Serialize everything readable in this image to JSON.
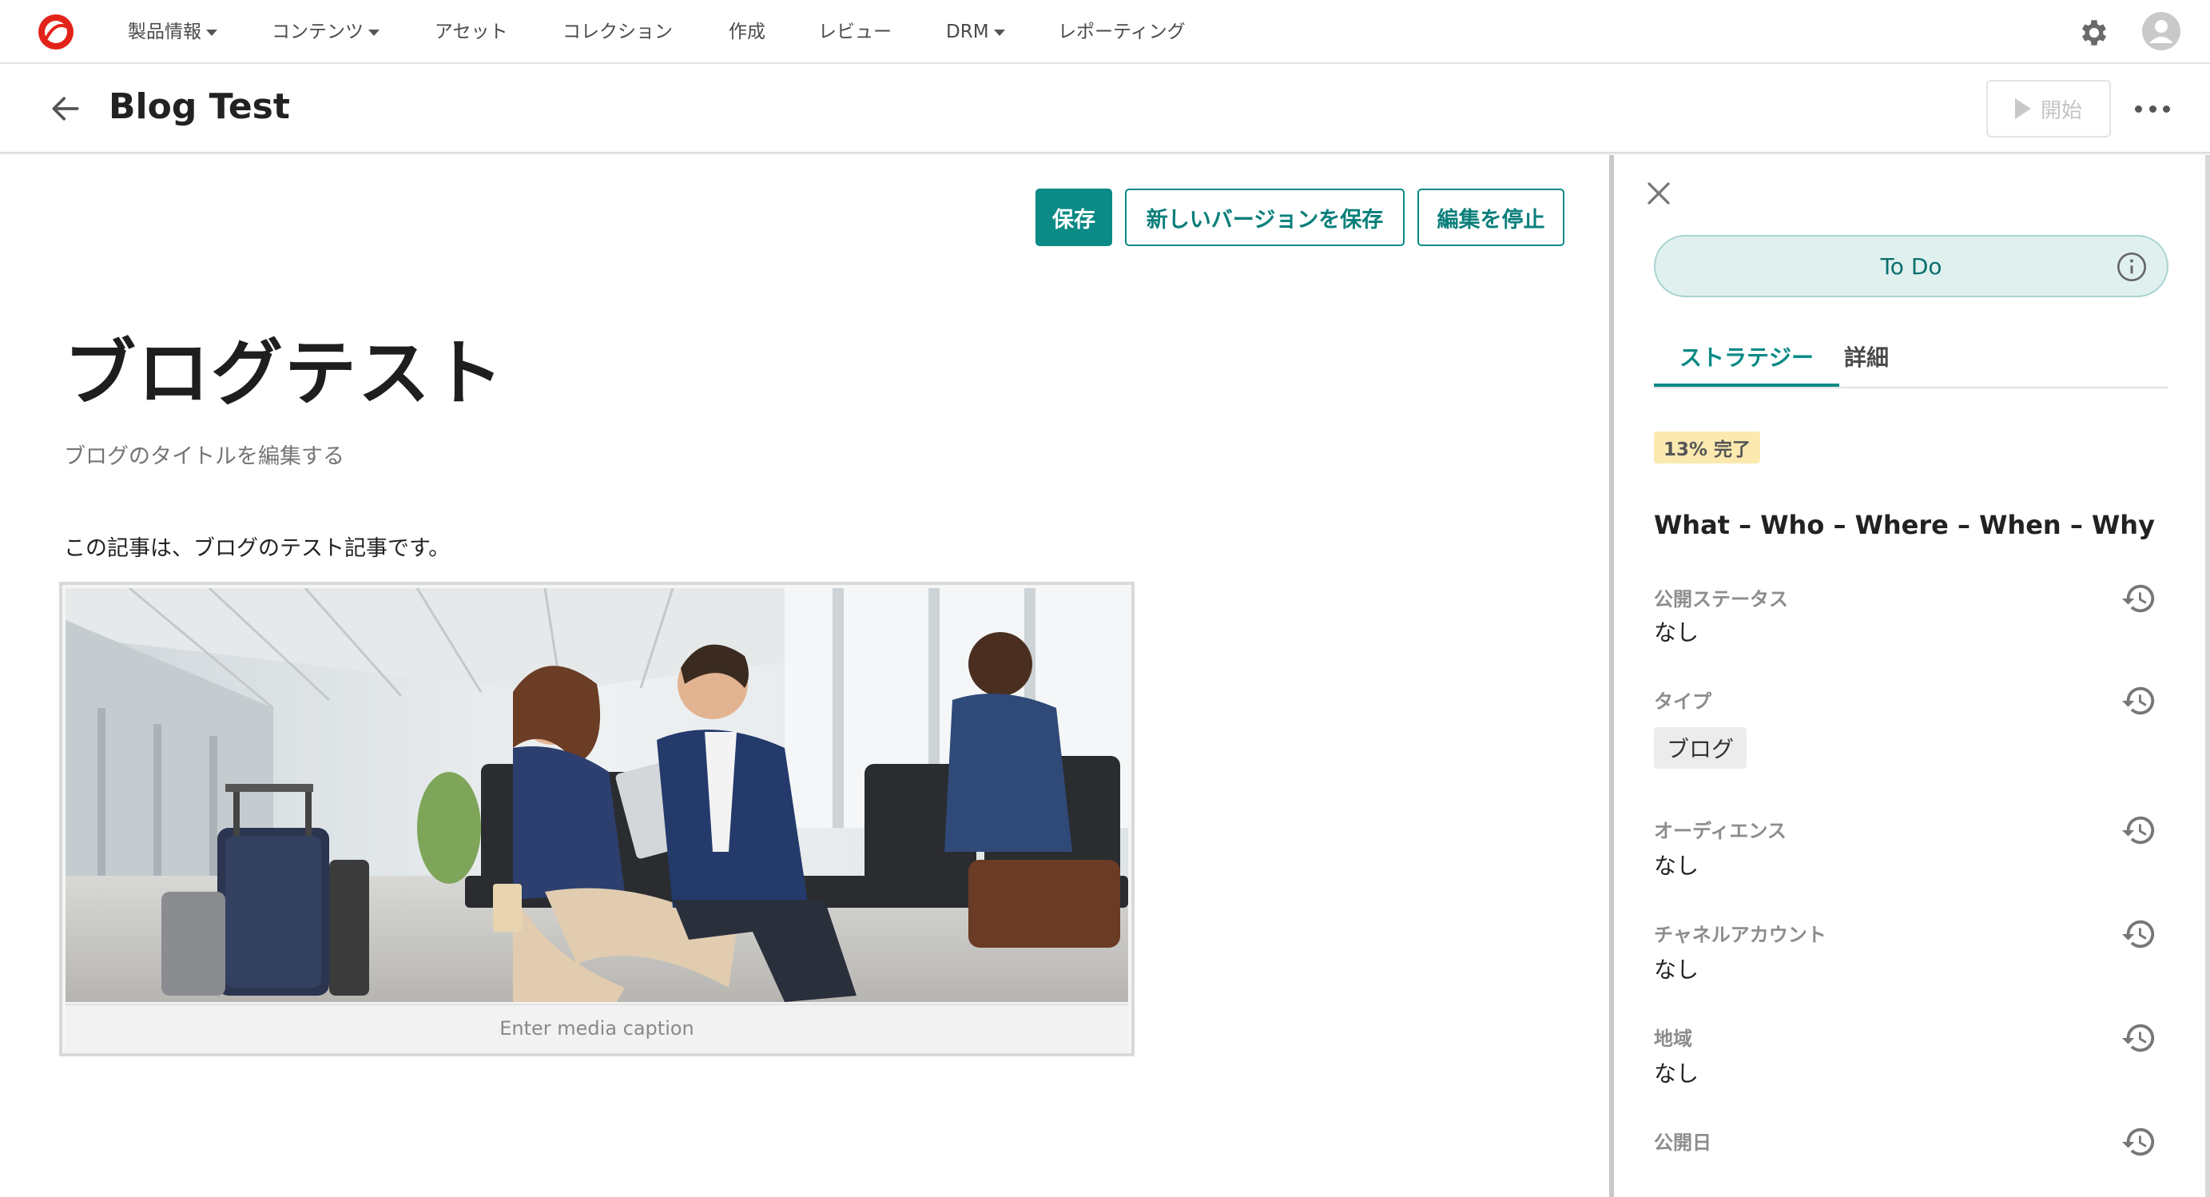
{
  "topnav": {
    "logo_name": "product-logo",
    "items": [
      {
        "label": "製品情報",
        "has_caret": true
      },
      {
        "label": "コンテンツ",
        "has_caret": true
      },
      {
        "label": "アセット",
        "has_caret": false
      },
      {
        "label": "コレクション",
        "has_caret": false
      },
      {
        "label": "作成",
        "has_caret": false
      },
      {
        "label": "レビュー",
        "has_caret": false
      },
      {
        "label": "DRM",
        "has_caret": true
      },
      {
        "label": "レポーティング",
        "has_caret": false
      }
    ]
  },
  "titlebar": {
    "title": "Blog Test",
    "start_label": "開始"
  },
  "editor": {
    "save_label": "保存",
    "save_version_label": "新しいバージョンを保存",
    "stop_edit_label": "編集を停止",
    "heading": "ブログテスト",
    "subtitle_placeholder": "ブログのタイトルを編集する",
    "body": "この記事は、ブログのテスト記事です。",
    "media_caption_placeholder": "Enter media caption"
  },
  "panel": {
    "status": "To Do",
    "tabs": [
      "ストラテジー",
      "詳細"
    ],
    "active_tab": "ストラテジー",
    "progress": "13% 完了",
    "progress_percent": 13,
    "strategy_heading": "What – Who – Where – When – Why",
    "fields": [
      {
        "label": "公開ステータス",
        "value": "なし"
      },
      {
        "label": "タイプ",
        "chip": "ブログ"
      },
      {
        "label": "オーディエンス",
        "value": "なし"
      },
      {
        "label": "チャネルアカウント",
        "value": "なし"
      },
      {
        "label": "地域",
        "value": "なし"
      },
      {
        "label": "公開日",
        "value": ""
      }
    ]
  },
  "colors": {
    "accent": "#0b8a86",
    "status_bg": "#dff0ef",
    "badge_bg": "#fbe9b0",
    "logo_red": "#e2231a"
  }
}
